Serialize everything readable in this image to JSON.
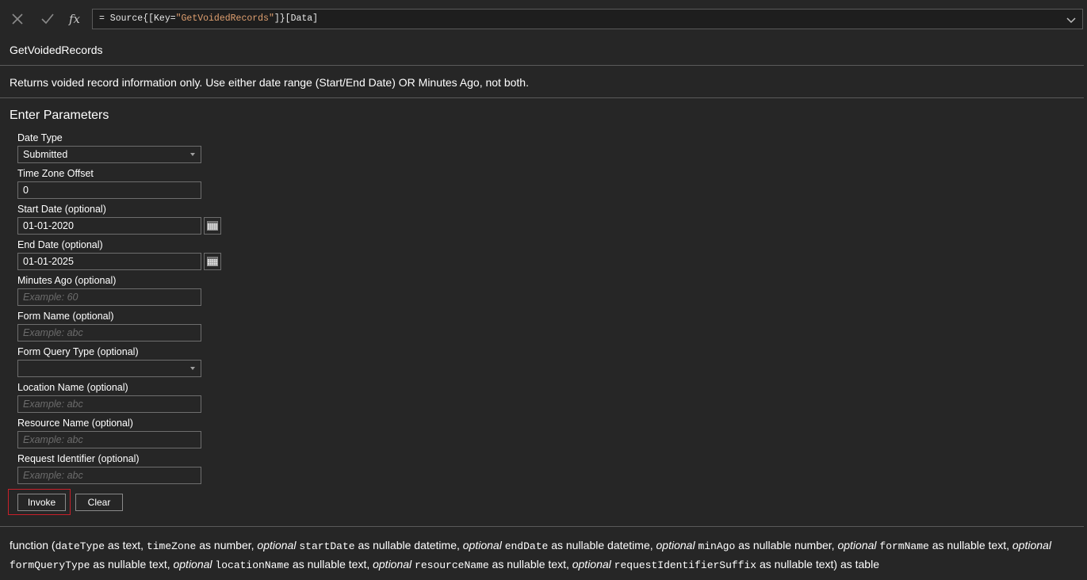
{
  "formula_bar": {
    "prefix": "= Source{[Key=",
    "key_string": "\"GetVoidedRecords\"",
    "suffix": "]}[Data]",
    "cancel_icon": "close-icon",
    "commit_icon": "check-icon",
    "fx_label": "fx"
  },
  "function": {
    "name": "GetVoidedRecords",
    "description": "Returns voided record information only. Use either date range (Start/End Date) OR Minutes Ago, not both."
  },
  "params_section": {
    "title": "Enter Parameters"
  },
  "params": [
    {
      "label": "Date Type",
      "value": "Submitted",
      "kind": "select"
    },
    {
      "label": "Time Zone Offset",
      "value": "0",
      "kind": "text"
    },
    {
      "label": "Start Date (optional)",
      "value": "01-01-2020",
      "kind": "date"
    },
    {
      "label": "End Date (optional)",
      "value": "01-01-2025",
      "kind": "date"
    },
    {
      "label": "Minutes Ago (optional)",
      "placeholder": "Example: 60",
      "kind": "text"
    },
    {
      "label": "Form Name (optional)",
      "placeholder": "Example: abc",
      "kind": "text"
    },
    {
      "label": "Form Query Type (optional)",
      "value": "",
      "kind": "select"
    },
    {
      "label": "Location Name (optional)",
      "placeholder": "Example: abc",
      "kind": "text"
    },
    {
      "label": "Resource Name (optional)",
      "placeholder": "Example: abc",
      "kind": "text"
    },
    {
      "label": "Request Identifier (optional)",
      "placeholder": "Example: abc",
      "kind": "text"
    }
  ],
  "buttons": {
    "invoke": "Invoke",
    "clear": "Clear"
  },
  "colors": {
    "background": "#262626",
    "highlight": "#c8202a",
    "string_literal": "#e0a070"
  },
  "signature": {
    "t0": "function (",
    "p_dateType": "dateType",
    "t1": " as text, ",
    "p_timeZone": "timeZone",
    "t2": " as number, ",
    "opt": "optional",
    "p_startDate": "startDate",
    "t3": " as nullable datetime, ",
    "p_endDate": "endDate",
    "t4": " as nullable datetime, ",
    "p_minAgo": "minAgo",
    "t5": " as nullable number, ",
    "p_formName": "formName",
    "t6": " as nullable text, ",
    "p_formQueryType": "formQueryType",
    "t7": " as nullable text, ",
    "p_locationName": "locationName",
    "t8": " as nullable text, ",
    "p_resourceName": "resourceName",
    "t9": " as nullable text, ",
    "p_requestIdentifierSuffix": "requestIdentifierSuffix",
    "t10": " as nullable text) as table"
  }
}
